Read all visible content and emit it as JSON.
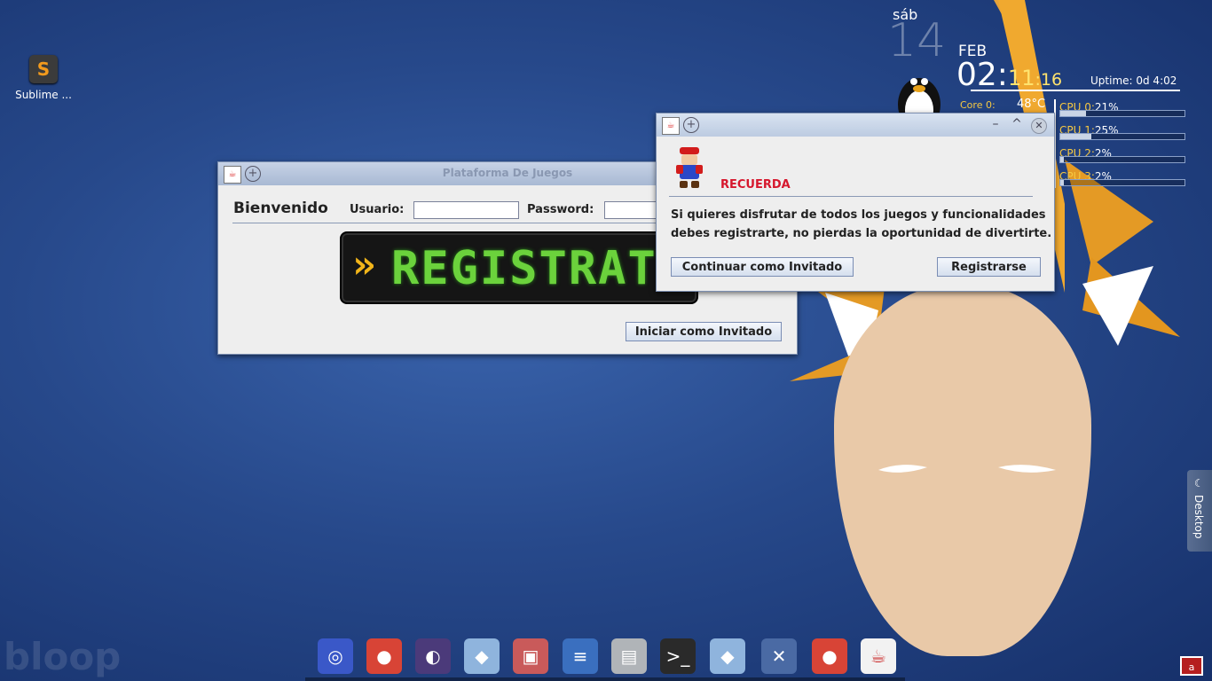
{
  "desktop": {
    "icons": [
      {
        "label": "Sublime ...",
        "icon": "sublime-text-icon"
      }
    ],
    "brand_watermark": "bloop"
  },
  "clock": {
    "weekday": "sáb",
    "day": "14",
    "month": "FEB",
    "hour": "02:",
    "minute": "11",
    "second": ":16",
    "uptime": "Uptime: 0d 4:02"
  },
  "sensors": {
    "core_label": "Core 0:",
    "core_temp": "48°C",
    "cpus": [
      {
        "label": "CPU 0:",
        "value": "21%",
        "fraction": 0.21
      },
      {
        "label": "CPU 1:",
        "value": "25%",
        "fraction": 0.25
      },
      {
        "label": "CPU 2:",
        "value": "2%",
        "fraction": 0.02
      },
      {
        "label": "CPU 3:",
        "value": "2%",
        "fraction": 0.02
      }
    ]
  },
  "main_window": {
    "title": "Plataforma De Juegos",
    "welcome": "Bienvenido",
    "user_label": "Usuario:",
    "user_value": "",
    "password_label": "Password:",
    "password_value": "",
    "banner_arrows": "»",
    "banner_text": "REGISTRATE",
    "guest_button": "Iniciar como Invitado"
  },
  "dialog": {
    "heading": "RECUERDA",
    "message_line1": "Si quieres disfrutar de todos los juegos y funcionalidades",
    "message_line2": "debes registrarte, no pierdas la oportunidad de divertirte.",
    "continue_button": "Continuar como Invitado",
    "register_button": "Registrarse"
  },
  "dock": {
    "apps": [
      {
        "name": "network-globe-icon",
        "color": "#3a58c8"
      },
      {
        "name": "chrome-icon",
        "color": "#d84436"
      },
      {
        "name": "eclipse-icon",
        "color": "#4b3a7a"
      },
      {
        "name": "virtualbox-cube-icon",
        "color": "#8fb4dd"
      },
      {
        "name": "media-manager-icon",
        "color": "#c95a5a"
      },
      {
        "name": "document-writer-icon",
        "color": "#3a6fbf"
      },
      {
        "name": "file-cabinet-icon",
        "color": "#b0b4b8"
      },
      {
        "name": "terminal-icon",
        "color": "#2a2a2a"
      },
      {
        "name": "virtualbox-cube-icon",
        "color": "#8fb4dd"
      },
      {
        "name": "settings-tools-icon",
        "color": "#4a6aa4"
      },
      {
        "name": "chrome-icon",
        "color": "#d84436"
      },
      {
        "name": "java-icon",
        "color": "#f2f2f2"
      }
    ]
  },
  "side_panel": {
    "label": "Desktop"
  }
}
